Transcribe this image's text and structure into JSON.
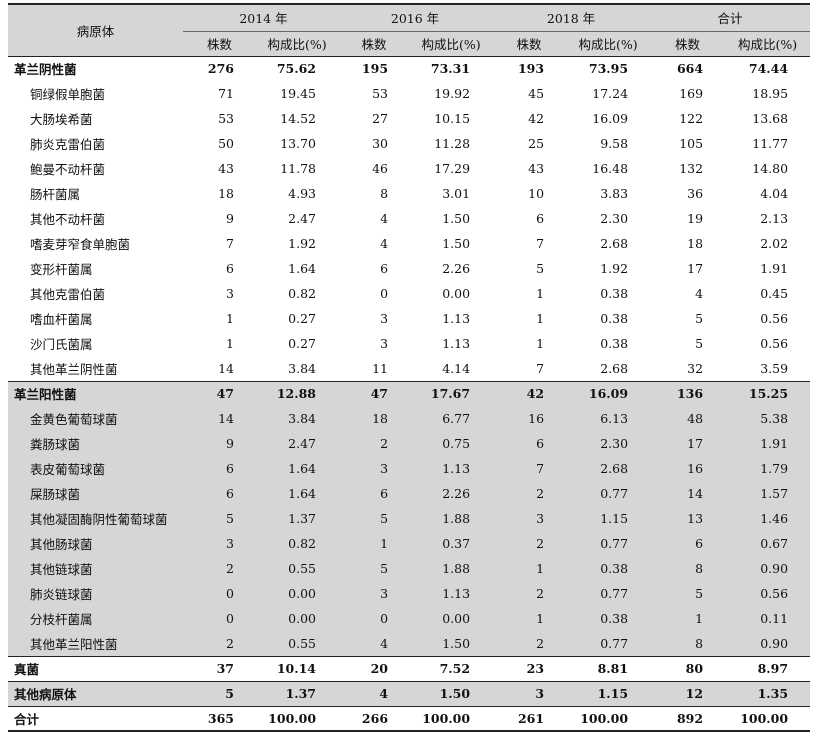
{
  "header": {
    "pathogen_label": "病原体",
    "years": [
      "2014 年",
      "2016 年",
      "2018 年",
      "合计"
    ],
    "count_label": "株数",
    "ratio_label": "构成比(%)"
  },
  "rows": [
    {
      "name": "革兰阴性菌",
      "bold": true,
      "shade": false,
      "sub": false,
      "v": [
        "276",
        "75.62",
        "195",
        "73.31",
        "193",
        "73.95",
        "664",
        "74.44"
      ]
    },
    {
      "name": "铜绿假单胞菌",
      "bold": false,
      "shade": false,
      "sub": true,
      "v": [
        "71",
        "19.45",
        "53",
        "19.92",
        "45",
        "17.24",
        "169",
        "18.95"
      ]
    },
    {
      "name": "大肠埃希菌",
      "bold": false,
      "shade": false,
      "sub": true,
      "v": [
        "53",
        "14.52",
        "27",
        "10.15",
        "42",
        "16.09",
        "122",
        "13.68"
      ]
    },
    {
      "name": "肺炎克雷伯菌",
      "bold": false,
      "shade": false,
      "sub": true,
      "v": [
        "50",
        "13.70",
        "30",
        "11.28",
        "25",
        "9.58",
        "105",
        "11.77"
      ]
    },
    {
      "name": "鲍曼不动杆菌",
      "bold": false,
      "shade": false,
      "sub": true,
      "v": [
        "43",
        "11.78",
        "46",
        "17.29",
        "43",
        "16.48",
        "132",
        "14.80"
      ]
    },
    {
      "name": "肠杆菌属",
      "bold": false,
      "shade": false,
      "sub": true,
      "v": [
        "18",
        "4.93",
        "8",
        "3.01",
        "10",
        "3.83",
        "36",
        "4.04"
      ]
    },
    {
      "name": "其他不动杆菌",
      "bold": false,
      "shade": false,
      "sub": true,
      "v": [
        "9",
        "2.47",
        "4",
        "1.50",
        "6",
        "2.30",
        "19",
        "2.13"
      ]
    },
    {
      "name": "嗜麦芽窄食单胞菌",
      "bold": false,
      "shade": false,
      "sub": true,
      "v": [
        "7",
        "1.92",
        "4",
        "1.50",
        "7",
        "2.68",
        "18",
        "2.02"
      ]
    },
    {
      "name": "变形杆菌属",
      "bold": false,
      "shade": false,
      "sub": true,
      "v": [
        "6",
        "1.64",
        "6",
        "2.26",
        "5",
        "1.92",
        "17",
        "1.91"
      ]
    },
    {
      "name": "其他克雷伯菌",
      "bold": false,
      "shade": false,
      "sub": true,
      "v": [
        "3",
        "0.82",
        "0",
        "0.00",
        "1",
        "0.38",
        "4",
        "0.45"
      ]
    },
    {
      "name": "嗜血杆菌属",
      "bold": false,
      "shade": false,
      "sub": true,
      "v": [
        "1",
        "0.27",
        "3",
        "1.13",
        "1",
        "0.38",
        "5",
        "0.56"
      ]
    },
    {
      "name": "沙门氏菌属",
      "bold": false,
      "shade": false,
      "sub": true,
      "v": [
        "1",
        "0.27",
        "3",
        "1.13",
        "1",
        "0.38",
        "5",
        "0.56"
      ]
    },
    {
      "name": "其他革兰阴性菌",
      "bold": false,
      "shade": false,
      "sub": true,
      "v": [
        "14",
        "3.84",
        "11",
        "4.14",
        "7",
        "2.68",
        "32",
        "3.59"
      ]
    },
    {
      "name": "革兰阳性菌",
      "bold": true,
      "shade": true,
      "sub": false,
      "sep": true,
      "v": [
        "47",
        "12.88",
        "47",
        "17.67",
        "42",
        "16.09",
        "136",
        "15.25"
      ]
    },
    {
      "name": "金黄色葡萄球菌",
      "bold": false,
      "shade": true,
      "sub": true,
      "v": [
        "14",
        "3.84",
        "18",
        "6.77",
        "16",
        "6.13",
        "48",
        "5.38"
      ]
    },
    {
      "name": "粪肠球菌",
      "bold": false,
      "shade": true,
      "sub": true,
      "v": [
        "9",
        "2.47",
        "2",
        "0.75",
        "6",
        "2.30",
        "17",
        "1.91"
      ]
    },
    {
      "name": "表皮葡萄球菌",
      "bold": false,
      "shade": true,
      "sub": true,
      "v": [
        "6",
        "1.64",
        "3",
        "1.13",
        "7",
        "2.68",
        "16",
        "1.79"
      ]
    },
    {
      "name": "屎肠球菌",
      "bold": false,
      "shade": true,
      "sub": true,
      "v": [
        "6",
        "1.64",
        "6",
        "2.26",
        "2",
        "0.77",
        "14",
        "1.57"
      ]
    },
    {
      "name": "其他凝固酶阴性葡萄球菌",
      "bold": false,
      "shade": true,
      "sub": true,
      "v": [
        "5",
        "1.37",
        "5",
        "1.88",
        "3",
        "1.15",
        "13",
        "1.46"
      ]
    },
    {
      "name": "其他肠球菌",
      "bold": false,
      "shade": true,
      "sub": true,
      "v": [
        "3",
        "0.82",
        "1",
        "0.37",
        "2",
        "0.77",
        "6",
        "0.67"
      ]
    },
    {
      "name": "其他链球菌",
      "bold": false,
      "shade": true,
      "sub": true,
      "v": [
        "2",
        "0.55",
        "5",
        "1.88",
        "1",
        "0.38",
        "8",
        "0.90"
      ]
    },
    {
      "name": "肺炎链球菌",
      "bold": false,
      "shade": true,
      "sub": true,
      "v": [
        "0",
        "0.00",
        "3",
        "1.13",
        "2",
        "0.77",
        "5",
        "0.56"
      ]
    },
    {
      "name": "分枝杆菌属",
      "bold": false,
      "shade": true,
      "sub": true,
      "v": [
        "0",
        "0.00",
        "0",
        "0.00",
        "1",
        "0.38",
        "1",
        "0.11"
      ]
    },
    {
      "name": "其他革兰阳性菌",
      "bold": false,
      "shade": true,
      "sub": true,
      "v": [
        "2",
        "0.55",
        "4",
        "1.50",
        "2",
        "0.77",
        "8",
        "0.90"
      ]
    },
    {
      "name": "真菌",
      "bold": true,
      "shade": false,
      "sub": false,
      "sep": true,
      "v": [
        "37",
        "10.14",
        "20",
        "7.52",
        "23",
        "8.81",
        "80",
        "8.97"
      ]
    },
    {
      "name": "其他病原体",
      "bold": true,
      "shade": true,
      "sub": false,
      "sep": true,
      "v": [
        "5",
        "1.37",
        "4",
        "1.50",
        "3",
        "1.15",
        "12",
        "1.35"
      ]
    },
    {
      "name": "合计",
      "bold": true,
      "shade": false,
      "sub": false,
      "sep": true,
      "last": true,
      "v": [
        "365",
        "100.00",
        "266",
        "100.00",
        "261",
        "100.00",
        "892",
        "100.00"
      ]
    }
  ]
}
